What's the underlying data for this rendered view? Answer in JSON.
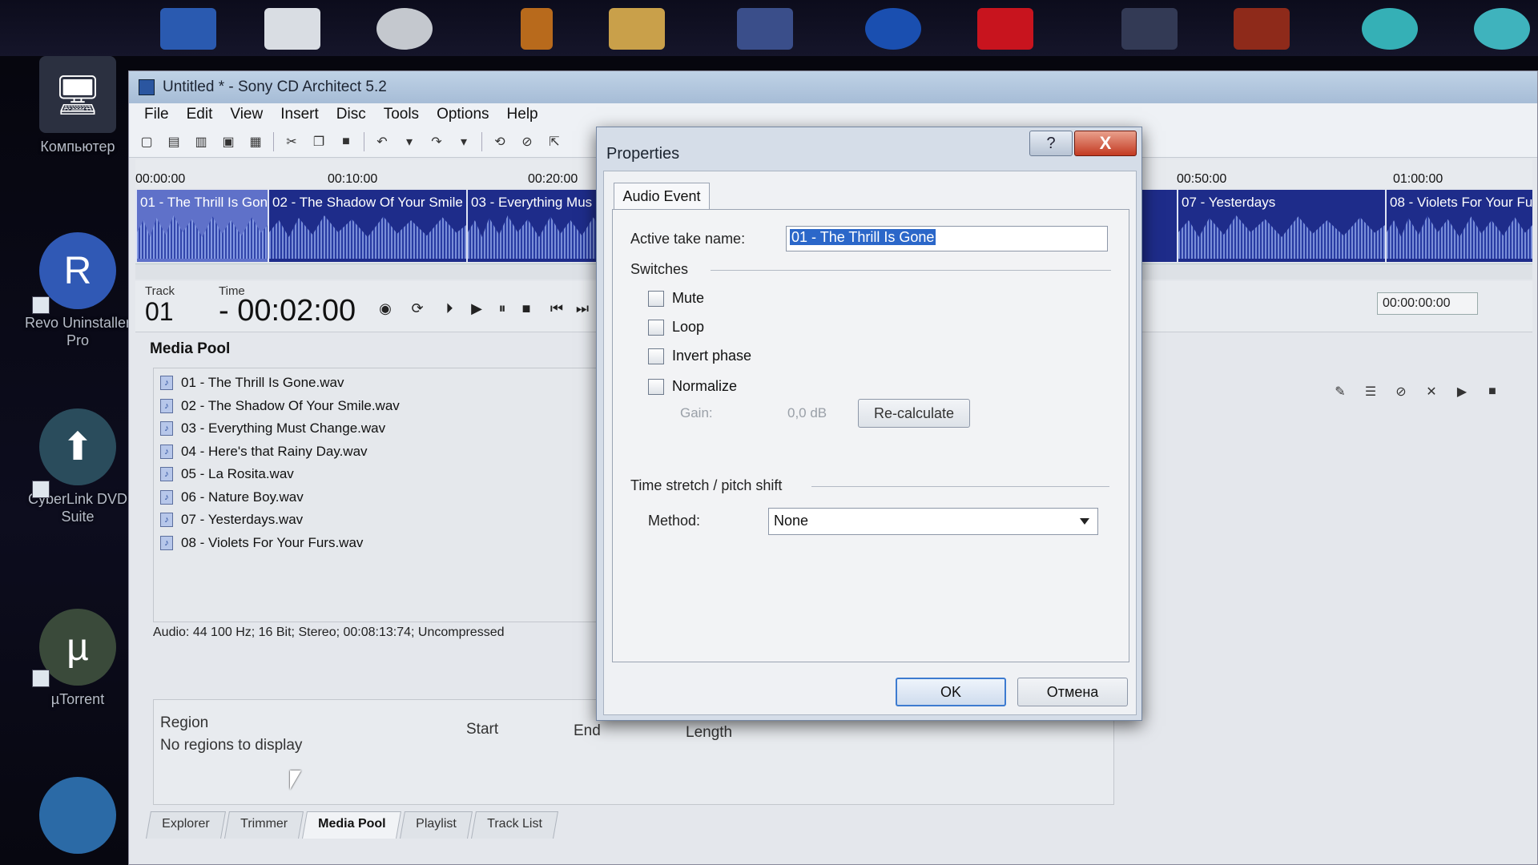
{
  "desktop": {
    "icons": [
      {
        "label": "Компьютер"
      },
      {
        "label": "Revo Uninstaller Pro"
      },
      {
        "label": "CyberLink DVD Suite"
      },
      {
        "label": "µTorrent"
      }
    ]
  },
  "window": {
    "title": "Untitled * - Sony CD Architect 5.2",
    "menu": [
      "File",
      "Edit",
      "View",
      "Insert",
      "Disc",
      "Tools",
      "Options",
      "Help"
    ]
  },
  "timeline": {
    "ruler": [
      "00:00:00",
      "00:10:00",
      "00:20:00",
      "00:50:00",
      "01:00:00"
    ],
    "clips": [
      {
        "name": "01 - The Thrill Is Gone"
      },
      {
        "name": "02 - The Shadow Of Your Smile"
      },
      {
        "name": "03 - Everything Mus"
      },
      {
        "name": "07 - Yesterdays"
      },
      {
        "name": "08 - Violets For Your Fu"
      }
    ]
  },
  "transport": {
    "track_label": "Track",
    "track_value": "01",
    "time_label": "Time",
    "time_value": "- 00:02:00",
    "right_time": "00:00:00:00"
  },
  "media_pool": {
    "title": "Media Pool",
    "items": [
      "01 - The Thrill Is Gone.wav",
      "02 - The Shadow Of Your Smile.wav",
      "03 - Everything Must Change.wav",
      "04 - Here's that Rainy Day.wav",
      "05 - La Rosita.wav",
      "06 - Nature Boy.wav",
      "07 - Yesterdays.wav",
      "08 - Violets For Your Furs.wav"
    ],
    "info": "Audio: 44 100 Hz; 16 Bit; Stereo; 00:08:13:74; Uncompressed"
  },
  "regions": {
    "headers": [
      "Region",
      "Start",
      "End",
      "Length"
    ],
    "empty": "No regions to display"
  },
  "tabs": [
    "Explorer",
    "Trimmer",
    "Media Pool",
    "Playlist",
    "Track List"
  ],
  "dialog": {
    "title": "Properties",
    "help": "?",
    "close": "X",
    "tab": "Audio Event",
    "active_take_label": "Active take name:",
    "active_take_value": "01 - The Thrill Is Gone",
    "switches_label": "Switches",
    "switches": [
      "Mute",
      "Loop",
      "Invert phase",
      "Normalize"
    ],
    "gain_label": "Gain:",
    "gain_value": "0,0 dB",
    "recalc": "Re-calculate",
    "stretch_label": "Time stretch / pitch shift",
    "method_label": "Method:",
    "method_value": "None",
    "ok": "OK",
    "cancel": "Отмена"
  }
}
